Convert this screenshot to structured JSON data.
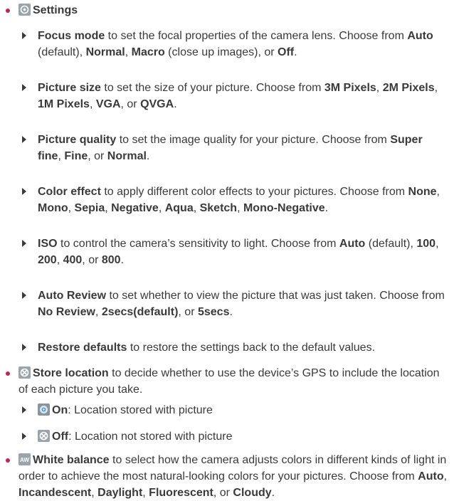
{
  "colors": {
    "bullet": "#c0245c",
    "text": "#3a3a3a",
    "icon_bg": "#9aa4ad"
  },
  "settings": {
    "label": "Settings",
    "items": [
      {
        "term": "Focus mode",
        "desc1": " to set the focal properties of the camera lens. Choose from ",
        "opt1": "Auto",
        "sep1": " (default), ",
        "opt2": "Normal",
        "sep2": ", ",
        "opt3": "Macro",
        "sep3": " (close up images), or ",
        "opt4": "Off",
        "end": "."
      },
      {
        "term": "Picture size",
        "desc1": " to set the size of your picture. Choose from ",
        "opt1": "3M Pixels",
        "sep1": ", ",
        "opt2": "2M Pixels",
        "sep2": ", ",
        "opt3": "1M Pixels",
        "sep3": ", ",
        "opt4": "VGA",
        "sep4": ", or ",
        "opt5": "QVGA",
        "end": "."
      },
      {
        "term": "Picture quality",
        "desc1": " to set the image quality for your picture. Choose from ",
        "opt1": "Super fine",
        "sep1": ", ",
        "opt2": "Fine",
        "sep2": ", or ",
        "opt3": "Normal",
        "end": "."
      },
      {
        "term": "Color effect",
        "desc1": " to apply different color effects to your pictures. Choose from ",
        "opt1": "None",
        "sep1": ", ",
        "opt2": "Mono",
        "sep2": ", ",
        "opt3": "Sepia",
        "sep3": ", ",
        "opt4": "Negative",
        "sep4": ", ",
        "opt5": "Aqua",
        "sep5": ", ",
        "opt6": "Sketch",
        "sep6": ", ",
        "opt7": "Mono-Negative",
        "end": "."
      },
      {
        "term": "ISO",
        "desc1": " to control the camera’s sensitivity to light. Choose from ",
        "opt1": "Auto",
        "sep1": " (default), ",
        "opt2": "100",
        "sep2": ", ",
        "opt3": "200",
        "sep3": ", ",
        "opt4": "400",
        "sep4": ", or ",
        "opt5": "800",
        "end": "."
      },
      {
        "term": "Auto Review",
        "desc1": " to set whether to view the picture that was just taken. Choose from ",
        "opt1": "No Review",
        "sep1": ", ",
        "opt2": "2secs(default)",
        "sep2": ", or ",
        "opt3": "5secs",
        "end": "."
      },
      {
        "term": "Restore defaults",
        "desc1": " to restore the settings back to the default values."
      }
    ]
  },
  "store_location": {
    "term": "Store location",
    "desc": " to decide whether to use the device’s GPS to include the location of each picture you take.",
    "options": [
      {
        "label": "On",
        "desc": ": Location stored with picture"
      },
      {
        "label": "Off",
        "desc": ": Location not stored with picture"
      }
    ]
  },
  "white_balance": {
    "term": "White balance",
    "desc1": " to select how the camera adjusts colors in different kinds of light in order to achieve the most natural-looking colors for your pictures. Choose from ",
    "opt1": "Auto",
    "sep1": ", ",
    "opt2": "Incandescent",
    "sep2": ", ",
    "opt3": "Daylight",
    "sep3": ", ",
    "opt4": "Fluorescent",
    "sep4": ", or ",
    "opt5": "Cloudy",
    "end": "."
  }
}
